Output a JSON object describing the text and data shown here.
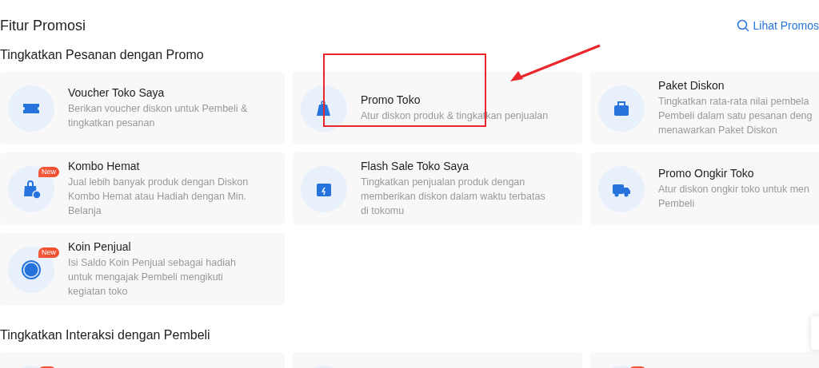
{
  "page": {
    "title": "Fitur Promosi",
    "link": "Lihat Promos"
  },
  "sections": [
    {
      "title": "Tingkatkan Pesanan dengan Promo",
      "cards": [
        {
          "title": "Voucher Toko Saya",
          "description": [
            "Berikan voucher diskon untuk Pembeli &",
            "tingkatkan pesanan"
          ],
          "new": false
        },
        {
          "title": "Promo Toko",
          "description": [
            "Atur diskon produk & tingkatkan penjualan"
          ],
          "new": false
        },
        {
          "title": "Paket Diskon",
          "description": [
            "Tingkatkan rata-rata nilai pembela",
            "Pembeli dalam satu pesanan deng",
            "menawarkan Paket Diskon"
          ],
          "new": false
        },
        {
          "title": "Kombo Hemat",
          "description": [
            "Jual lebih banyak produk dengan Diskon",
            "Kombo Hemat atau Hadiah dengan Min.",
            "Belanja"
          ],
          "new": true,
          "badge": "New"
        },
        {
          "title": "Flash Sale Toko Saya",
          "description": [
            "Tingkatkan penjualan produk dengan",
            "memberikan diskon dalam waktu terbatas",
            "di tokomu"
          ],
          "new": false
        },
        {
          "title": "Promo Ongkir Toko",
          "description": [
            "Atur diskon ongkir toko untuk men",
            "Pembeli"
          ],
          "new": false
        },
        {
          "title": "Koin Penjual",
          "description": [
            "Isi Saldo Koin Penjual sebagai hadiah",
            "untuk mengajak Pembeli mengikuti",
            "kegiatan toko"
          ],
          "new": true,
          "badge": "New"
        }
      ]
    },
    {
      "title": "Tingkatkan Interaksi dengan Pembeli",
      "cards": [
        {
          "new": true
        },
        {
          "new": false
        },
        {
          "new": true
        }
      ]
    }
  ],
  "annotations": {
    "highlight_box": true,
    "arrow": true
  }
}
